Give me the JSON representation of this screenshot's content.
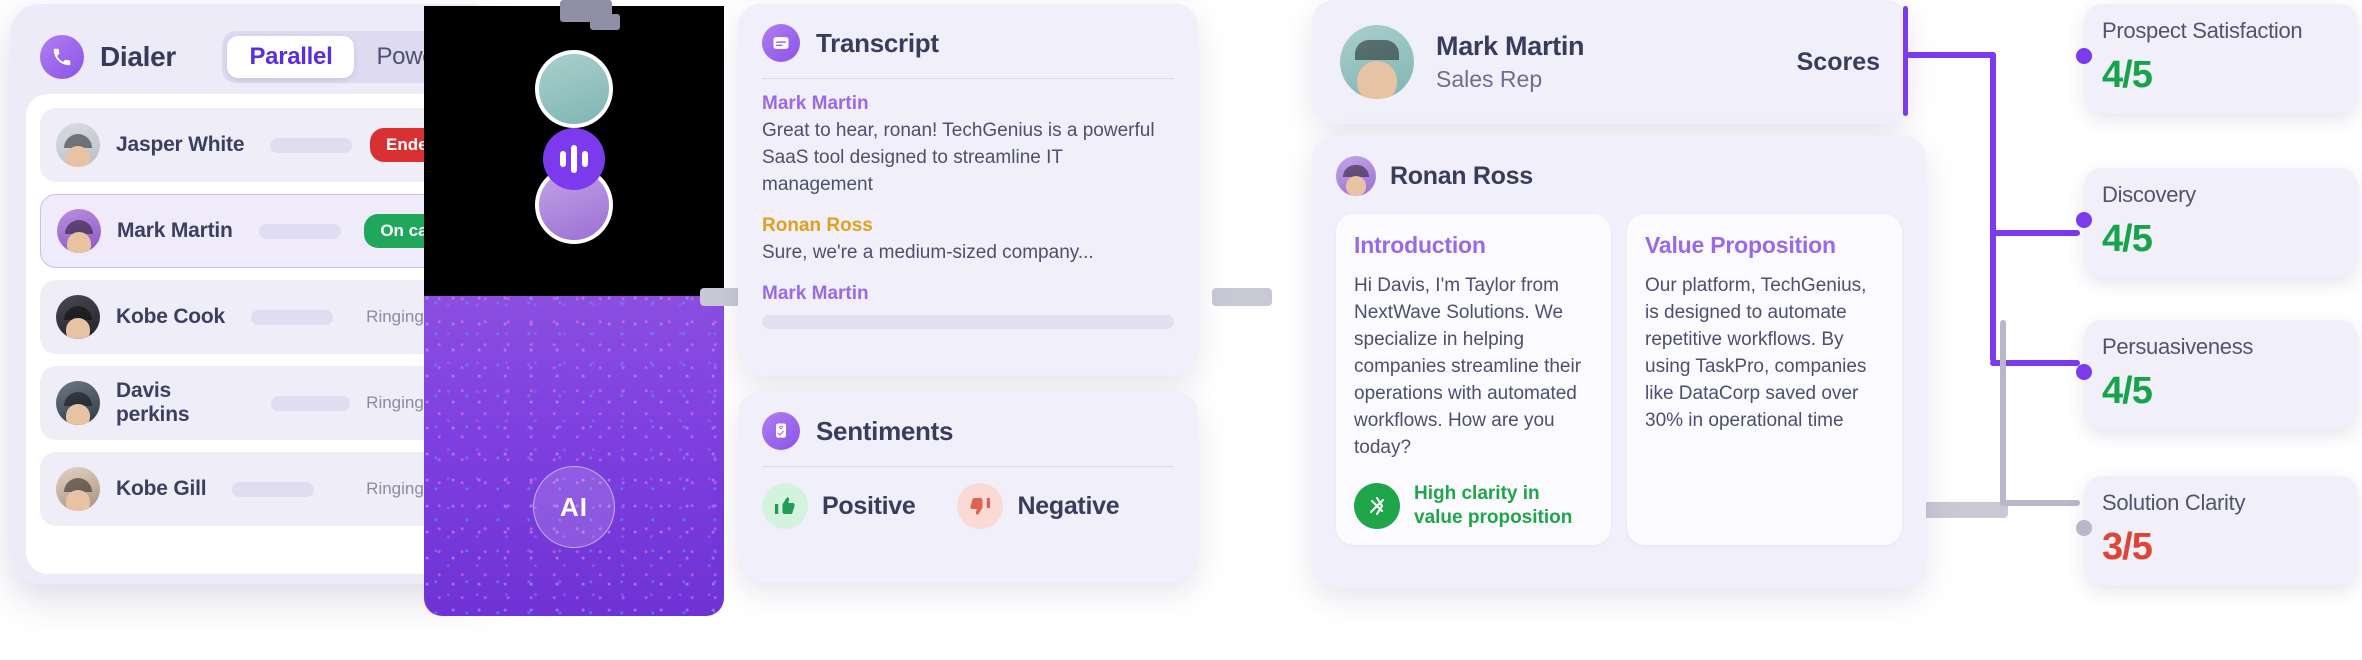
{
  "dialer": {
    "title": "Dialer",
    "phone_icon": "phone-icon",
    "modes": [
      {
        "label": "Parallel",
        "active": true
      },
      {
        "label": "Power",
        "active": false
      }
    ],
    "calls": [
      {
        "name": "Jasper White",
        "status": "Ended",
        "status_type": "ended"
      },
      {
        "name": "Mark Martin",
        "status": "On call",
        "status_type": "oncall"
      },
      {
        "name": "Kobe Cook",
        "status": "Ringing...",
        "status_type": "ringing"
      },
      {
        "name": "Davis perkins",
        "status": "Ringing...",
        "status_type": "ringing"
      },
      {
        "name": "Kobe Gill",
        "status": "Ringing...",
        "status_type": "ringing"
      }
    ]
  },
  "video": {
    "ai_label": "AI",
    "mic_icon": "waveform-icon"
  },
  "transcript": {
    "title": "Transcript",
    "icon": "transcript-icon",
    "entries": [
      {
        "speaker": "Mark Martin",
        "speaker_color": "purple",
        "text": "Great to hear, ronan! TechGenius is a powerful SaaS tool designed to streamline IT management"
      },
      {
        "speaker": "Ronan Ross",
        "speaker_color": "amber",
        "text": "Sure, we're a medium-sized company..."
      },
      {
        "speaker": "Mark Martin",
        "speaker_color": "purple",
        "text": ""
      }
    ]
  },
  "sentiments": {
    "title": "Sentiments",
    "icon": "sentiments-icon",
    "options": [
      {
        "label": "Positive",
        "icon": "thumbs-up-icon",
        "glyph": "👍"
      },
      {
        "label": "Negative",
        "icon": "thumbs-down-icon",
        "glyph": "👎"
      }
    ]
  },
  "rep": {
    "name": "Mark Martin",
    "role": "Sales Rep",
    "scores_label": "Scores"
  },
  "analysis": {
    "prospect_name": "Ronan Ross",
    "cards": [
      {
        "title": "Introduction",
        "body": "Hi Davis, I'm Taylor from NextWave Solutions. We specialize in helping companies streamline their operations with automated workflows. How are you today?",
        "note": "High clarity in value proposition",
        "note_icon": "clarity-check-icon"
      },
      {
        "title": "Value Proposition",
        "body": "Our platform, TechGenius, is designed to automate repetitive workflows. By using TaskPro, companies like DataCorp saved over 30% in operational time",
        "note": "",
        "note_icon": ""
      }
    ]
  },
  "scores": [
    {
      "name": "Prospect Satisfaction",
      "value": "4/5",
      "tone": "green",
      "dot": "purple"
    },
    {
      "name": "Discovery",
      "value": "4/5",
      "tone": "green",
      "dot": "purple"
    },
    {
      "name": "Persuasiveness",
      "value": "4/5",
      "tone": "green",
      "dot": "purple"
    },
    {
      "name": "Solution Clarity",
      "value": "3/5",
      "tone": "red",
      "dot": "grey"
    }
  ],
  "colors": {
    "accent": "#7c3aed",
    "purple_text": "#9a6ae6",
    "amber_text": "#e0a11c",
    "green": "#16a34a",
    "red": "#e04434",
    "ended": "#d93131",
    "oncall": "#1fa85b"
  }
}
